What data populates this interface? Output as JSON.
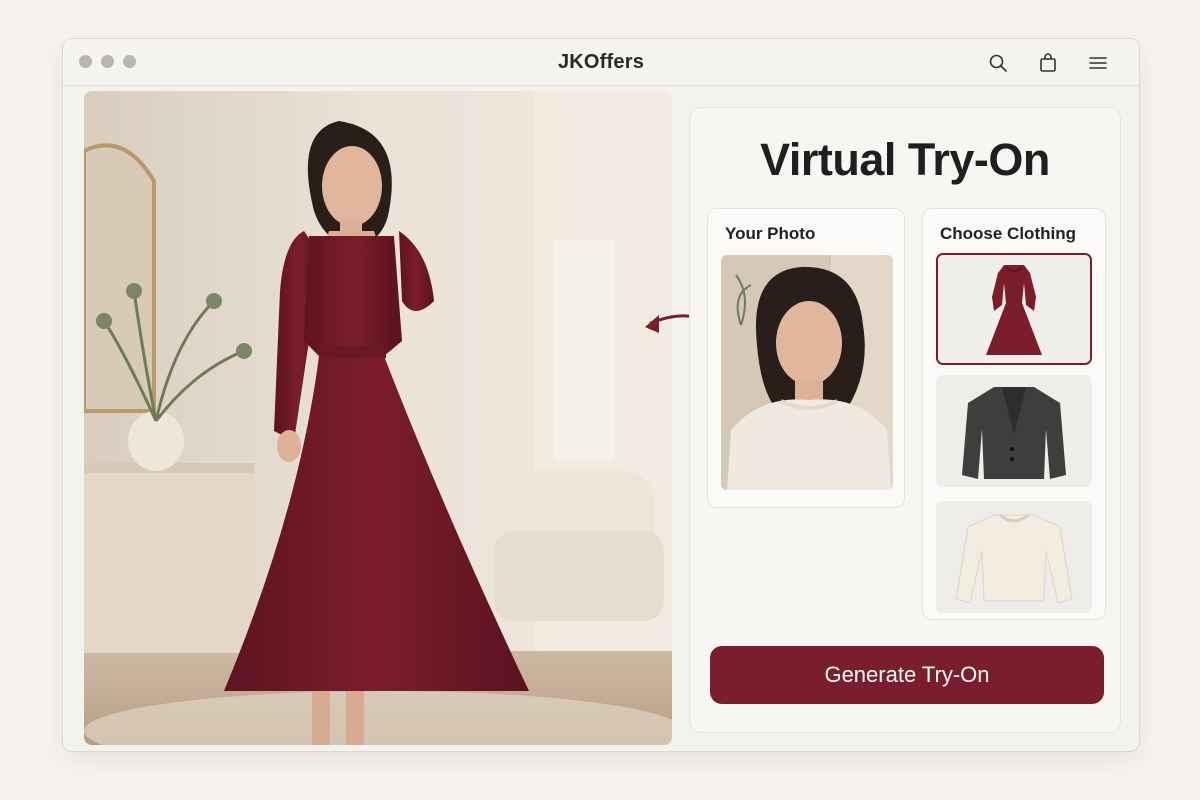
{
  "window": {
    "title": "JKOffers",
    "controls": [
      "close",
      "minimize",
      "maximize"
    ]
  },
  "toolbar": {
    "icons": [
      "search-icon",
      "shopping-bag-icon",
      "menu-icon"
    ]
  },
  "panel": {
    "title": "Virtual Try-On",
    "your_photo_label": "Your Photo",
    "choose_clothing_label": "Choose Clothing",
    "clothing_items": [
      {
        "item": "burgundy dress",
        "selected": true
      },
      {
        "item": "charcoal blazer",
        "selected": false
      },
      {
        "item": "cream sweater",
        "selected": false
      }
    ],
    "generate_label": "Generate Try-On"
  },
  "colors": {
    "accent": "#7a1d2c",
    "background": "#f7f4ef",
    "panel": "#f8f6f3"
  }
}
